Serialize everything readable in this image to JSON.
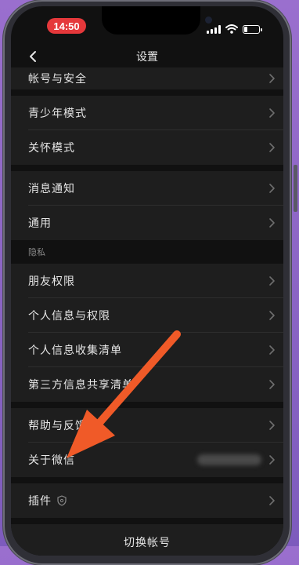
{
  "status_bar": {
    "time": "14:50",
    "icons": [
      "cellular-signal-icon",
      "wifi-icon",
      "battery-icon"
    ],
    "battery_level": 0.25,
    "time_pill_color": "#e5383b"
  },
  "nav": {
    "title": "设置",
    "back_icon": "chevron-left-icon"
  },
  "settings": {
    "account_security": "帐号与安全",
    "youth_mode": "青少年模式",
    "care_mode": "关怀模式",
    "notifications": "消息通知",
    "general": "通用",
    "privacy_section": "隐私",
    "friend_permissions": "朋友权限",
    "personal_info_permissions": "个人信息与权限",
    "personal_info_list": "个人信息收集清单",
    "third_party_list": "第三方信息共享清单",
    "help_feedback": "帮助与反馈",
    "about_wechat": "关于微信",
    "plugins": "插件",
    "plugins_icon": "shield-icon",
    "switch_account": "切换帐号"
  },
  "annotation": {
    "arrow_color": "#f05a28",
    "points_to": "about_wechat"
  },
  "colors": {
    "background": "#111111",
    "row_background": "#1e1e1e",
    "text": "#e6e6e6",
    "chevron": "#6e6e6e"
  }
}
